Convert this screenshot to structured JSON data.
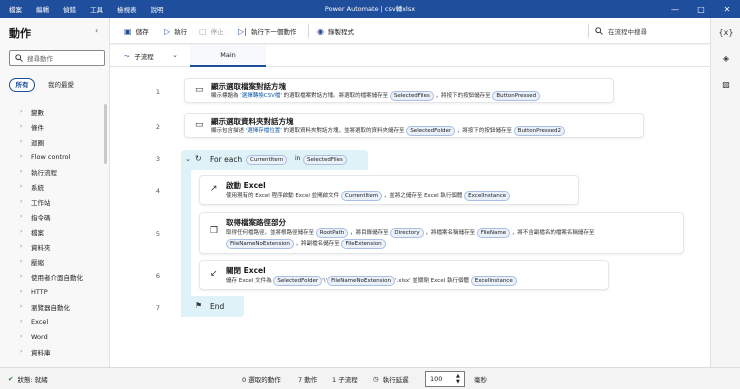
{
  "window": {
    "title": "Power Automate | csv轉xlsx",
    "controls": [
      "—",
      "□",
      "✕"
    ]
  },
  "menu": [
    "檔案",
    "編輯",
    "偵錯",
    "工具",
    "檢視表",
    "說明"
  ],
  "left_pane": {
    "title": "動作",
    "search_placeholder": "搜尋動作",
    "tabs": [
      "所有",
      "我的最愛"
    ],
    "categories": [
      "變數",
      "條件",
      "迴圈",
      "Flow control",
      "執行流程",
      "系統",
      "工作站",
      "指令碼",
      "檔案",
      "資料夾",
      "壓縮",
      "使用者介面自動化",
      "HTTP",
      "瀏覽器自動化",
      "Excel",
      "Word",
      "資料庫"
    ]
  },
  "toolbar": {
    "save": "儲存",
    "run": "執行",
    "stop": "停止",
    "run_next": "執行下一個動作",
    "record": "錄製程式",
    "search_placeholder": "在流程中搜尋"
  },
  "subbar": {
    "subflows_label": "子流程",
    "main_tab": "Main"
  },
  "lines": [
    "1",
    "2",
    "3",
    "4",
    "5",
    "6",
    "7"
  ],
  "steps": {
    "s1": {
      "title": "顯示選取檔案對話方塊",
      "d1": "顯示標題為",
      "q": "'選擇轉換CSV檔'",
      "d2": "的選取檔案對話方塊。將選取的檔案儲存至",
      "v1": "SelectedFiles",
      "d3": "，將按下的按鈕儲存至",
      "v2": "ButtonPressed"
    },
    "s2": {
      "title": "顯示選取資料夾對話方塊",
      "d1": "顯示包含描述",
      "q": "'選擇存檔位置'",
      "d2": "的選取資料夾對話方塊，並將選取的資料夾儲存至",
      "v1": "SelectedFolder",
      "d3": "，將按下的按鈕儲存至",
      "v2": "ButtonPressed2"
    },
    "s3": {
      "label": "For each",
      "var": "CurrentItem",
      "in": "in",
      "list": "SelectedFiles"
    },
    "s4": {
      "title": "啟動 Excel",
      "d1": "使用現有的 Excel 程序啟動 Excel 並開啟文件",
      "v1": "CurrentItem",
      "d2": "，並將之儲存至 Excel 執行個體",
      "v2": "ExcelInstance"
    },
    "s5": {
      "title": "取得檔案路徑部分",
      "d1": "取得任何檔路徑，並將根路徑儲存至",
      "v1": "RootPath",
      "d2": "，將目錄儲存至",
      "v2": "Directory",
      "d3": "，將檔案名稱儲存至",
      "v3": "FileName",
      "d4": "，將不含副檔名的檔案名稱儲存至",
      "v4": "FileNameNoExtension",
      "d5": "，將副檔名儲存至",
      "v5": "FileExtension"
    },
    "s6": {
      "title": "關閉 Excel",
      "d1": "儲存 Excel 文件為",
      "v1": "SelectedFolder",
      "s1": "'\\'",
      "v2": "FileNameNoExtension",
      "s2": "'.xlsx'",
      "d2": "並關閉 Excel 執行個體",
      "v3": "ExcelInstance"
    },
    "s7": {
      "label": "End"
    }
  },
  "status": {
    "state": "狀態: 就緒",
    "selected": "0 選取的動作",
    "actions": "7 動作",
    "subflows": "1 子流程",
    "delay_label": "執行延遲",
    "delay_value": "100",
    "unit": "毫秒"
  },
  "icons": {
    "save": "save-icon",
    "run": "play-icon",
    "stop": "stop-icon",
    "run_next": "step-icon",
    "record": "record-icon"
  },
  "colors": {
    "titlebar": "#1f4e9c",
    "loop_bg": "#dff2f7",
    "accent": "#1f4e9c"
  }
}
